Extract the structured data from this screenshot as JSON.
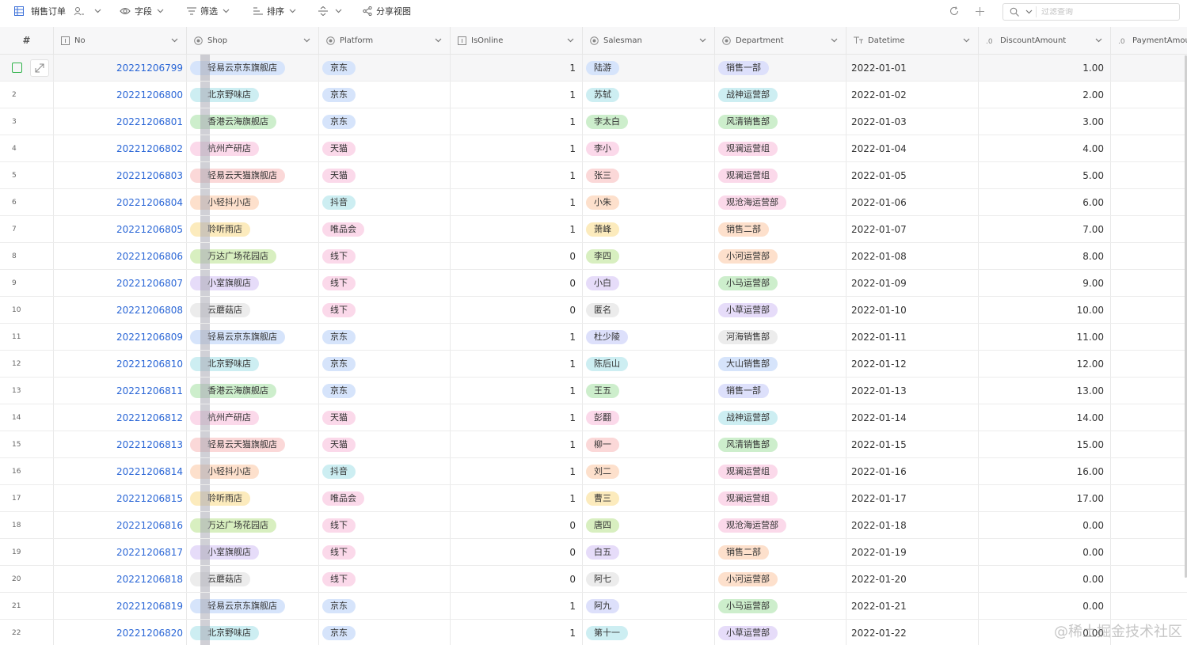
{
  "toolbar": {
    "view_name": "销售订单",
    "fields_label": "字段",
    "filter_label": "筛选",
    "sort_label": "排序",
    "share_label": "分享视图",
    "search_placeholder": "过滤查询"
  },
  "columns": {
    "hash": "#",
    "no": "No",
    "shop": "Shop",
    "platform": "Platform",
    "isonline": "IsOnline",
    "salesman": "Salesman",
    "department": "Department",
    "datetime": "Datetime",
    "discount": "DiscountAmount",
    "payment": "PaymentAmou"
  },
  "tag_colors": {
    "blue": "#d6e4fb",
    "teal": "#cdeef2",
    "green": "#cdeecc",
    "pink": "#fbd9ea",
    "red": "#fbd8d8",
    "orange": "#fde0cc",
    "yellow": "#fcebbd",
    "purple": "#e6dcf9",
    "gray": "#ececec",
    "lime": "#d8efc0",
    "lavender": "#dde0fb"
  },
  "rows": [
    {
      "index": "1",
      "no": "20221206799",
      "shop": "轻易云京东旗舰店",
      "shop_color": "blue",
      "platform": "京东",
      "platform_color": "blue",
      "isonline": "1",
      "salesman": "陆游",
      "salesman_color": "blue",
      "department": "销售一部",
      "department_color": "lavender",
      "datetime": "2022-01-01",
      "discount": "1.00"
    },
    {
      "index": "2",
      "no": "20221206800",
      "shop": "北京野味店",
      "shop_color": "teal",
      "platform": "京东",
      "platform_color": "blue",
      "isonline": "1",
      "salesman": "苏轼",
      "salesman_color": "teal",
      "department": "战神运营部",
      "department_color": "teal",
      "datetime": "2022-01-02",
      "discount": "2.00"
    },
    {
      "index": "3",
      "no": "20221206801",
      "shop": "香港云海旗舰店",
      "shop_color": "green",
      "platform": "京东",
      "platform_color": "blue",
      "isonline": "1",
      "salesman": "李太白",
      "salesman_color": "green",
      "department": "风清销售部",
      "department_color": "green",
      "datetime": "2022-01-03",
      "discount": "3.00"
    },
    {
      "index": "4",
      "no": "20221206802",
      "shop": "杭州产研店",
      "shop_color": "pink",
      "platform": "天猫",
      "platform_color": "pink",
      "isonline": "1",
      "salesman": "李小",
      "salesman_color": "pink",
      "department": "观澜运营组",
      "department_color": "pink",
      "datetime": "2022-01-04",
      "discount": "4.00"
    },
    {
      "index": "5",
      "no": "20221206803",
      "shop": "轻易云天猫旗舰店",
      "shop_color": "red",
      "platform": "天猫",
      "platform_color": "pink",
      "isonline": "1",
      "salesman": "张三",
      "salesman_color": "red",
      "department": "观澜运营组",
      "department_color": "pink",
      "datetime": "2022-01-05",
      "discount": "5.00"
    },
    {
      "index": "6",
      "no": "20221206804",
      "shop": "小轻抖小店",
      "shop_color": "orange",
      "platform": "抖音",
      "platform_color": "teal",
      "isonline": "1",
      "salesman": "小朱",
      "salesman_color": "orange",
      "department": "观沧海运营部",
      "department_color": "pink",
      "datetime": "2022-01-06",
      "discount": "6.00"
    },
    {
      "index": "7",
      "no": "20221206805",
      "shop": "聆听雨店",
      "shop_color": "yellow",
      "platform": "唯品会",
      "platform_color": "pink",
      "isonline": "1",
      "salesman": "萧峰",
      "salesman_color": "yellow",
      "department": "销售二部",
      "department_color": "orange",
      "datetime": "2022-01-07",
      "discount": "7.00"
    },
    {
      "index": "8",
      "no": "20221206806",
      "shop": "万达广场花园店",
      "shop_color": "lime",
      "platform": "线下",
      "platform_color": "pink",
      "isonline": "0",
      "salesman": "李四",
      "salesman_color": "lime",
      "department": "小河运营部",
      "department_color": "orange",
      "datetime": "2022-01-08",
      "discount": "8.00"
    },
    {
      "index": "9",
      "no": "20221206807",
      "shop": "小室旗舰店",
      "shop_color": "purple",
      "platform": "线下",
      "platform_color": "pink",
      "isonline": "0",
      "salesman": "小白",
      "salesman_color": "purple",
      "department": "小马运营部",
      "department_color": "green",
      "datetime": "2022-01-09",
      "discount": "9.00"
    },
    {
      "index": "10",
      "no": "20221206808",
      "shop": "云蘑菇店",
      "shop_color": "gray",
      "platform": "线下",
      "platform_color": "pink",
      "isonline": "0",
      "salesman": "匿名",
      "salesman_color": "gray",
      "department": "小草运营部",
      "department_color": "purple",
      "datetime": "2022-01-10",
      "discount": "10.00"
    },
    {
      "index": "11",
      "no": "20221206809",
      "shop": "轻易云京东旗舰店",
      "shop_color": "blue",
      "platform": "京东",
      "platform_color": "blue",
      "isonline": "1",
      "salesman": "杜少陵",
      "salesman_color": "lavender",
      "department": "河海销售部",
      "department_color": "gray",
      "datetime": "2022-01-11",
      "discount": "11.00"
    },
    {
      "index": "12",
      "no": "20221206810",
      "shop": "北京野味店",
      "shop_color": "teal",
      "platform": "京东",
      "platform_color": "blue",
      "isonline": "1",
      "salesman": "陈后山",
      "salesman_color": "teal",
      "department": "大山销售部",
      "department_color": "blue",
      "datetime": "2022-01-12",
      "discount": "12.00"
    },
    {
      "index": "13",
      "no": "20221206811",
      "shop": "香港云海旗舰店",
      "shop_color": "green",
      "platform": "京东",
      "platform_color": "blue",
      "isonline": "1",
      "salesman": "王五",
      "salesman_color": "green",
      "department": "销售一部",
      "department_color": "lavender",
      "datetime": "2022-01-13",
      "discount": "13.00"
    },
    {
      "index": "14",
      "no": "20221206812",
      "shop": "杭州产研店",
      "shop_color": "pink",
      "platform": "天猫",
      "platform_color": "pink",
      "isonline": "1",
      "salesman": "彭翻",
      "salesman_color": "pink",
      "department": "战神运营部",
      "department_color": "teal",
      "datetime": "2022-01-14",
      "discount": "14.00"
    },
    {
      "index": "15",
      "no": "20221206813",
      "shop": "轻易云天猫旗舰店",
      "shop_color": "red",
      "platform": "天猫",
      "platform_color": "pink",
      "isonline": "1",
      "salesman": "柳一",
      "salesman_color": "red",
      "department": "风清销售部",
      "department_color": "green",
      "datetime": "2022-01-15",
      "discount": "15.00"
    },
    {
      "index": "16",
      "no": "20221206814",
      "shop": "小轻抖小店",
      "shop_color": "orange",
      "platform": "抖音",
      "platform_color": "teal",
      "isonline": "1",
      "salesman": "刘二",
      "salesman_color": "orange",
      "department": "观澜运营组",
      "department_color": "pink",
      "datetime": "2022-01-16",
      "discount": "16.00"
    },
    {
      "index": "17",
      "no": "20221206815",
      "shop": "聆听雨店",
      "shop_color": "yellow",
      "platform": "唯品会",
      "platform_color": "pink",
      "isonline": "1",
      "salesman": "曹三",
      "salesman_color": "yellow",
      "department": "观澜运营组",
      "department_color": "pink",
      "datetime": "2022-01-17",
      "discount": "17.00"
    },
    {
      "index": "18",
      "no": "20221206816",
      "shop": "万达广场花园店",
      "shop_color": "lime",
      "platform": "线下",
      "platform_color": "pink",
      "isonline": "0",
      "salesman": "唐四",
      "salesman_color": "lime",
      "department": "观沧海运营部",
      "department_color": "pink",
      "datetime": "2022-01-18",
      "discount": "0.00"
    },
    {
      "index": "19",
      "no": "20221206817",
      "shop": "小室旗舰店",
      "shop_color": "purple",
      "platform": "线下",
      "platform_color": "pink",
      "isonline": "0",
      "salesman": "白五",
      "salesman_color": "purple",
      "department": "销售二部",
      "department_color": "orange",
      "datetime": "2022-01-19",
      "discount": "0.00"
    },
    {
      "index": "20",
      "no": "20221206818",
      "shop": "云蘑菇店",
      "shop_color": "gray",
      "platform": "线下",
      "platform_color": "pink",
      "isonline": "0",
      "salesman": "阿七",
      "salesman_color": "gray",
      "department": "小河运营部",
      "department_color": "orange",
      "datetime": "2022-01-20",
      "discount": "0.00"
    },
    {
      "index": "21",
      "no": "20221206819",
      "shop": "轻易云京东旗舰店",
      "shop_color": "blue",
      "platform": "京东",
      "platform_color": "blue",
      "isonline": "1",
      "salesman": "阿九",
      "salesman_color": "lavender",
      "department": "小马运营部",
      "department_color": "green",
      "datetime": "2022-01-21",
      "discount": "0.00"
    },
    {
      "index": "22",
      "no": "20221206820",
      "shop": "北京野味店",
      "shop_color": "teal",
      "platform": "京东",
      "platform_color": "blue",
      "isonline": "1",
      "salesman": "第十一",
      "salesman_color": "teal",
      "department": "小草运营部",
      "department_color": "purple",
      "datetime": "2022-01-22",
      "discount": "0.00"
    }
  ],
  "watermark": "@稀土掘金技术社区"
}
